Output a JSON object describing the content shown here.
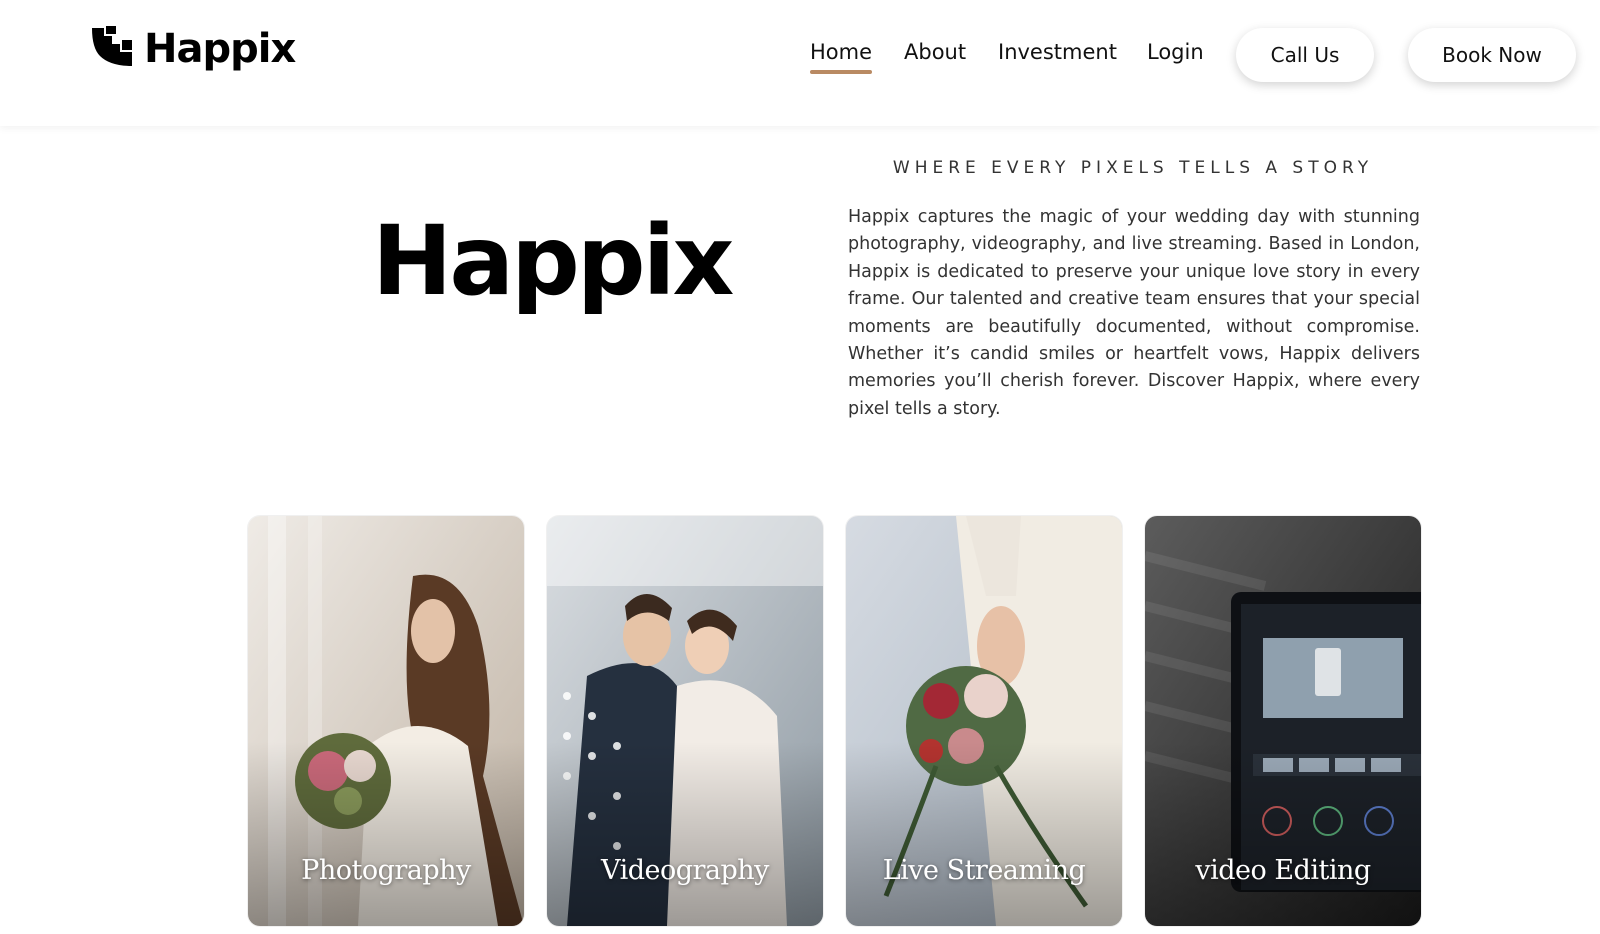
{
  "brand": {
    "name": "Happix",
    "accent": "#b98a63"
  },
  "nav": {
    "links": [
      {
        "label": "Home",
        "active": true
      },
      {
        "label": "About",
        "active": false
      },
      {
        "label": "Investment",
        "active": false
      },
      {
        "label": "Login",
        "active": false
      }
    ],
    "call_label": "Call Us",
    "book_label": "Book Now"
  },
  "hero": {
    "logo_text": "Happix",
    "tagline": "WHERE EVERY PIXELS TELLS A STORY",
    "intro": "Happix captures the magic of your wedding day with stunning photography, videography, and live streaming. Based in London, Happix is dedicated to preserve your unique love story in every frame. Our talented and creative team ensures that your special moments are beautifully documented, without compromise. Whether it’s candid smiles or heartfelt vows, Happix delivers memories you’ll cherish forever. Discover Happix, where every pixel tells a story."
  },
  "services": [
    {
      "label": "Photography"
    },
    {
      "label": "Videography"
    },
    {
      "label": "Live Streaming"
    },
    {
      "label": "video Editing"
    }
  ]
}
